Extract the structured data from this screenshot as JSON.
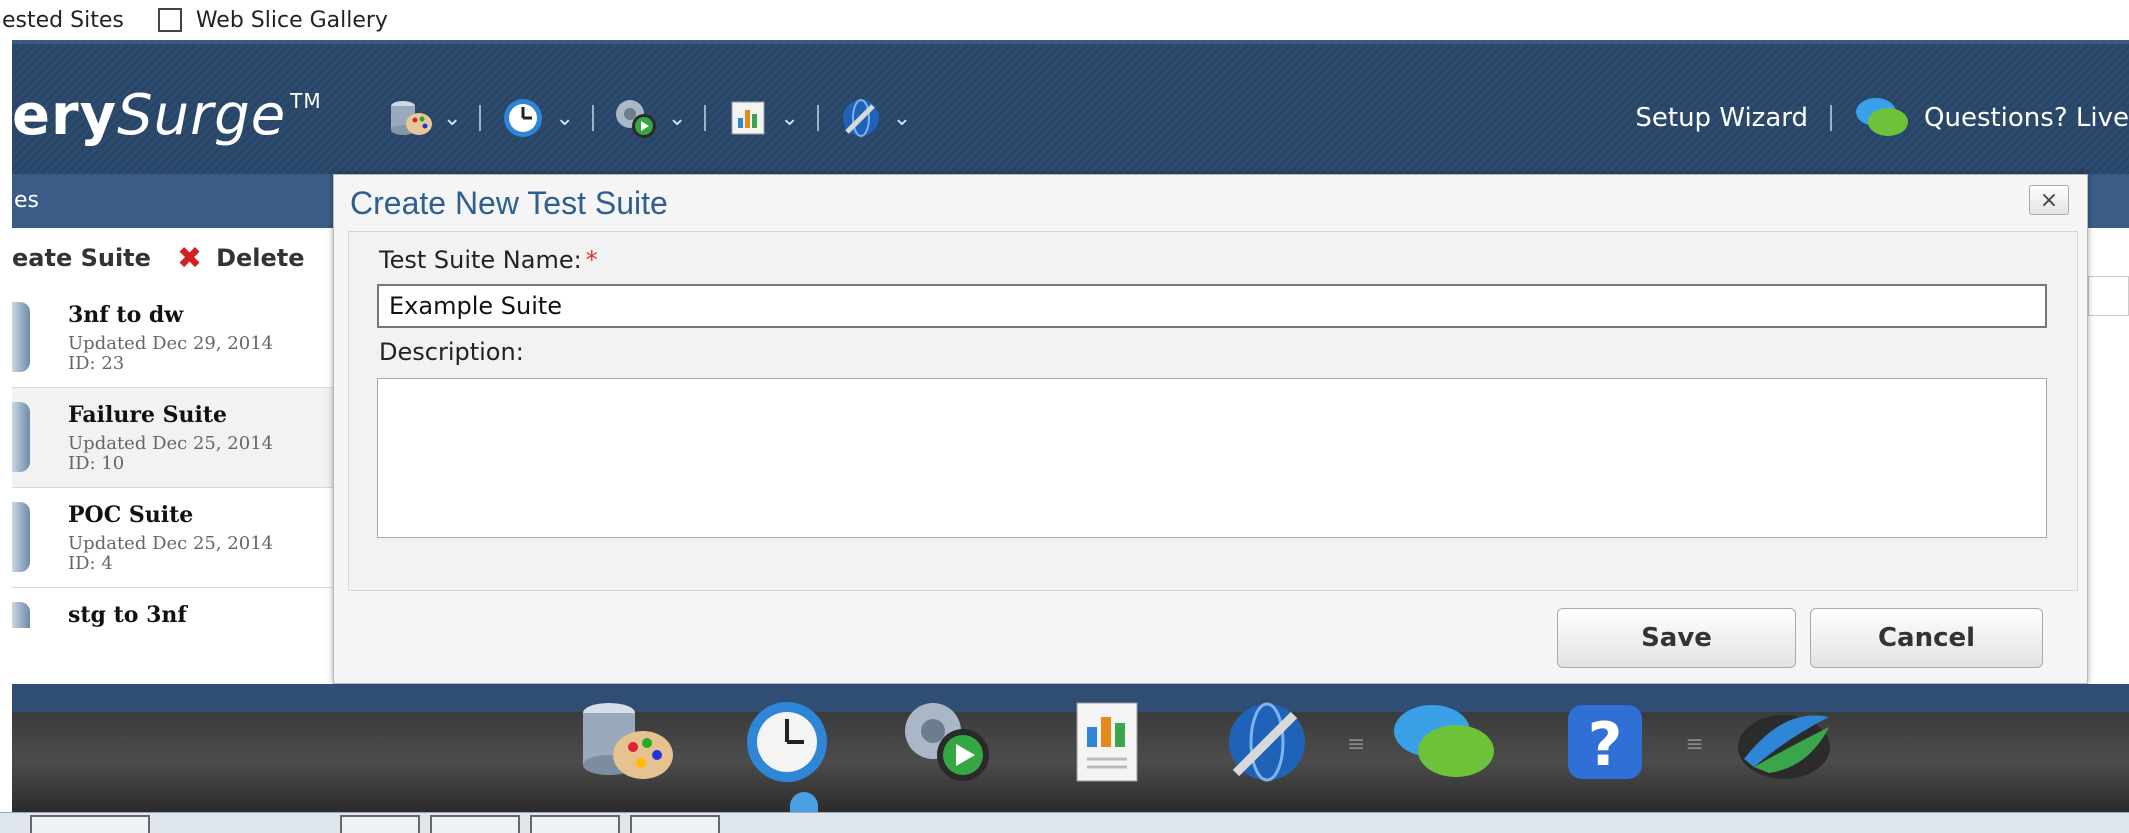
{
  "favorites": {
    "item1": "ested Sites",
    "item2": "Web Slice Gallery"
  },
  "header": {
    "brand_bold": "ery",
    "brand_italic": "Surge",
    "brand_tm": "TM",
    "setup_wizard": "Setup Wizard",
    "questions": "Questions? Live"
  },
  "panel": {
    "title": "es",
    "create_suite": "eate Suite",
    "delete": "Delete"
  },
  "suites": [
    {
      "name": "3nf to dw",
      "updated": "Updated Dec 29, 2014",
      "id": "ID: 23"
    },
    {
      "name": "Failure Suite",
      "updated": "Updated Dec 25, 2014",
      "id": "ID: 10"
    },
    {
      "name": "POC Suite",
      "updated": "Updated Dec 25, 2014",
      "id": "ID: 4"
    },
    {
      "name": "stg to 3nf",
      "updated": "",
      "id": ""
    }
  ],
  "dialog": {
    "title": "Create New Test Suite",
    "close": "×",
    "name_label": "Test Suite Name:",
    "required": "*",
    "name_value": "Example Suite",
    "description_label": "Description:",
    "description_value": "",
    "save": "Save",
    "cancel": "Cancel"
  },
  "colors": {
    "header_bg": "#2d4b6f",
    "title_blue": "#2e5f8e",
    "required_red": "#e03030"
  }
}
